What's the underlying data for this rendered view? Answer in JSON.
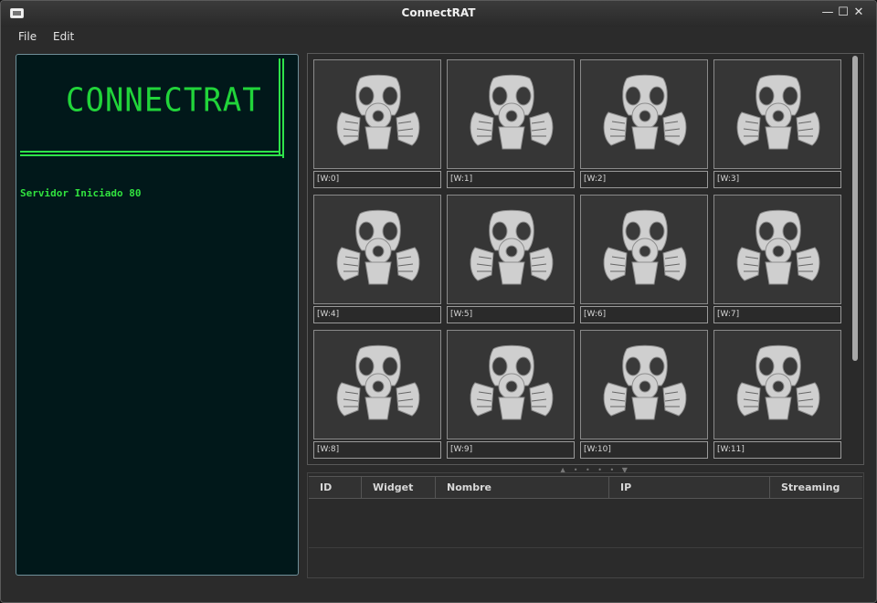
{
  "window": {
    "title": "ConnectRAT"
  },
  "controls": {
    "minimize": "—",
    "maximize": "☐",
    "close": "✕"
  },
  "menu": {
    "file": "File",
    "edit": "Edit"
  },
  "console": {
    "logo_text": "CONNECTRAT",
    "log_line": "Servidor Iniciado 80"
  },
  "widgets": [
    {
      "label": "[W:0]"
    },
    {
      "label": "[W:1]"
    },
    {
      "label": "[W:2]"
    },
    {
      "label": "[W:3]"
    },
    {
      "label": "[W:4]"
    },
    {
      "label": "[W:5]"
    },
    {
      "label": "[W:6]"
    },
    {
      "label": "[W:7]"
    },
    {
      "label": "[W:8]"
    },
    {
      "label": "[W:9]"
    },
    {
      "label": "[W:10]"
    },
    {
      "label": "[W:11]"
    }
  ],
  "table": {
    "columns": [
      "ID",
      "Widget",
      "Nombre",
      "IP",
      "Streaming"
    ],
    "rows": []
  },
  "splitter": {
    "glyphs": "▲ • • • • ▼"
  },
  "icons": {
    "widget_thumb": "gas-mask-icon"
  },
  "colors": {
    "console_bg": "#01181a",
    "console_text": "#31e23f",
    "logo": "#21d43a"
  }
}
